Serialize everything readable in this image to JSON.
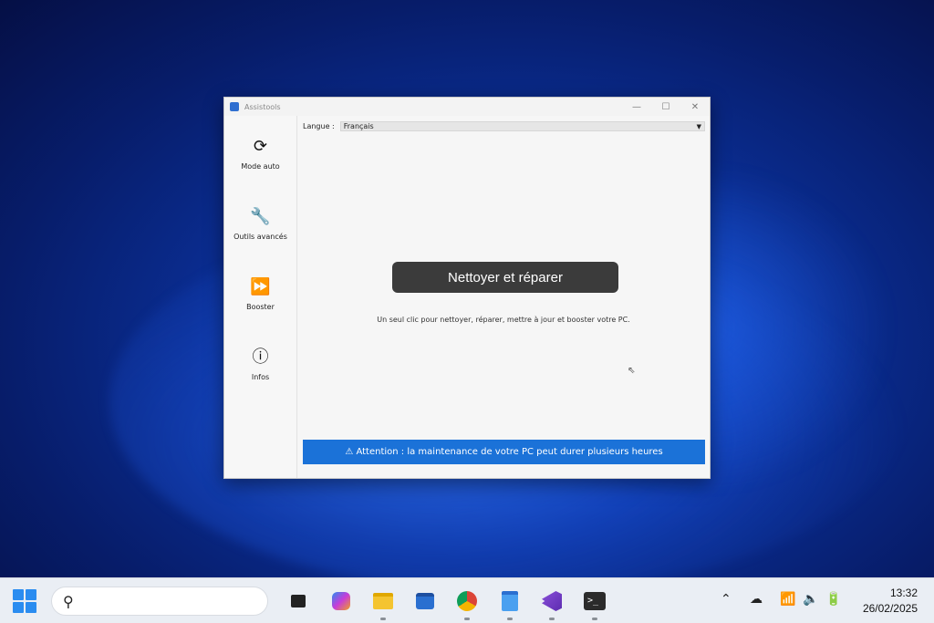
{
  "window": {
    "title": "Assistools",
    "controls": {
      "minimize": "—",
      "maximize": "☐",
      "close": "✕"
    }
  },
  "sidebar": {
    "items": [
      {
        "label": "Mode auto",
        "icon": "refresh-icon",
        "glyph": "⟳"
      },
      {
        "label": "Outils avancés",
        "icon": "wrench-icon",
        "glyph": "🔧"
      },
      {
        "label": "Booster",
        "icon": "fast-forward-icon",
        "glyph": "⏩"
      },
      {
        "label": "Infos",
        "icon": "info-icon",
        "glyph": "ⓘ"
      }
    ]
  },
  "main": {
    "language_label": "Langue :",
    "language_value": "Français",
    "primary_button": "Nettoyer et réparer",
    "description": "Un seul clic pour nettoyer, réparer, mettre à jour et booster votre PC.",
    "warning": "⚠ Attention : la maintenance de votre PC peut durer plusieurs heures"
  },
  "taskbar": {
    "apps": [
      "task-view",
      "copilot",
      "file-explorer",
      "microsoft-store",
      "chrome",
      "notepad",
      "visual-studio",
      "terminal"
    ],
    "tray_icons": [
      "chevron-up-icon",
      "onedrive-icon",
      "wifi-icon",
      "volume-icon",
      "battery-icon"
    ],
    "time": "13:32",
    "date": "26/02/2025"
  },
  "colors": {
    "accent": "#1b72d8",
    "button_dark": "#3b3b3b"
  }
}
